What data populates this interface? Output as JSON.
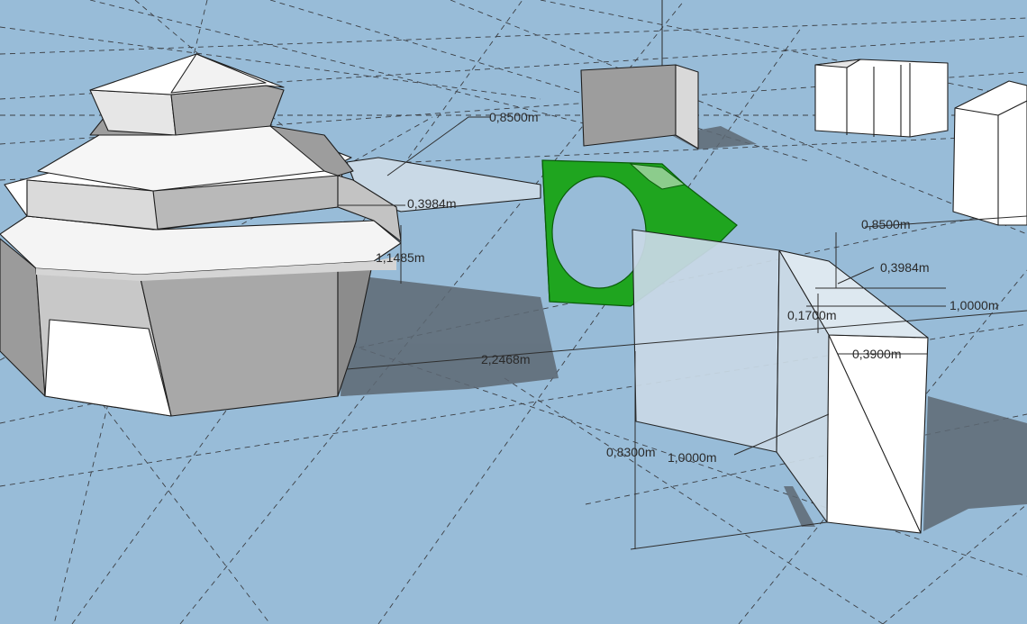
{
  "viewport": {
    "background_color": "#98bcd8",
    "shadow_color": "#5d6873",
    "selection_color": "#1fa51f",
    "dimensions": {
      "top_far": "0,8500m",
      "left_offset": "0,3984m",
      "left_height": "1,1485m",
      "center_span": "2,2468m",
      "right_far": "0,8500m",
      "right_offset": "0,3984m",
      "right_length": "1,0000m",
      "right_step": "0,1700m",
      "right_width": "0,3900m",
      "bottom_height": "0,8300m",
      "bottom_length": "1,0000m"
    }
  }
}
